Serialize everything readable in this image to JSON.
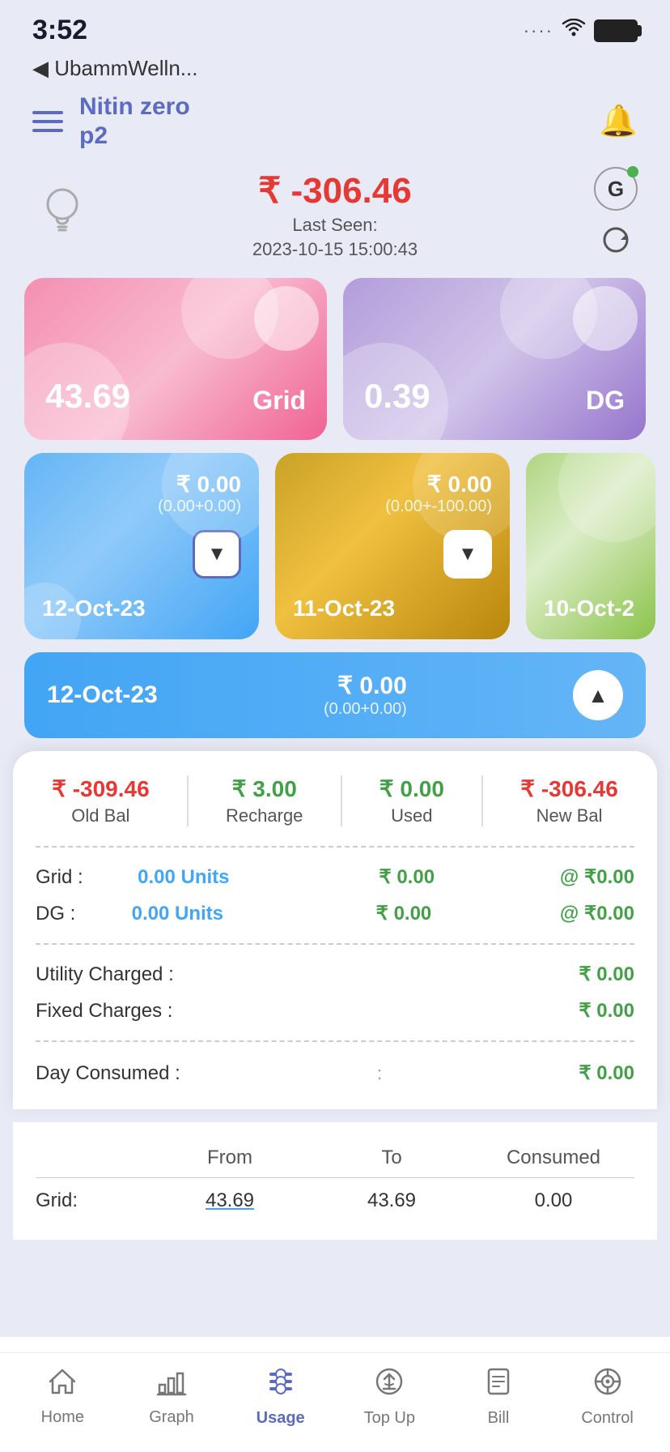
{
  "statusBar": {
    "time": "3:52",
    "backLabel": "◀ UbammWelln..."
  },
  "header": {
    "title": "Nitin zero\np2",
    "menuIcon": "☰",
    "bellIcon": "🔔"
  },
  "balance": {
    "amount": "₹ -306.46",
    "lastSeen": "Last Seen:",
    "lastSeenDate": "2023-10-15 15:00:43",
    "gLabel": "G"
  },
  "gridCard": {
    "value": "43.69",
    "label": "Grid"
  },
  "dgCard": {
    "value": "0.39",
    "label": "DG"
  },
  "dateCards": [
    {
      "amount": "₹ 0.00",
      "sub": "(0.00+0.00)",
      "date": "12-Oct-23",
      "type": "blue"
    },
    {
      "amount": "₹ 0.00",
      "sub": "(0.00+-100.00)",
      "date": "11-Oct-23",
      "type": "gold"
    },
    {
      "amount": "",
      "sub": "",
      "date": "10-Oct-2",
      "type": "green"
    }
  ],
  "expandedCard": {
    "date": "12-Oct-23",
    "amount": "₹ 0.00",
    "sub": "(0.00+0.00)"
  },
  "balanceDetail": {
    "oldBal": {
      "amount": "₹ -309.46",
      "label": "Old Bal"
    },
    "recharge": {
      "amount": "₹ 3.00",
      "label": "Recharge"
    },
    "used": {
      "amount": "₹ 0.00",
      "label": "Used"
    },
    "newBal": {
      "amount": "₹ -306.46",
      "label": "New Bal"
    }
  },
  "unitRows": [
    {
      "label": "Grid :",
      "units": "0.00 Units",
      "price": "₹ 0.00",
      "rate": "@ ₹0.00"
    },
    {
      "label": "DG :",
      "units": "0.00 Units",
      "price": "₹ 0.00",
      "rate": "@ ₹0.00"
    }
  ],
  "charges": [
    {
      "label": "Utility Charged :",
      "value": "₹ 0.00"
    },
    {
      "label": "Fixed Charges :",
      "value": "₹ 0.00"
    }
  ],
  "dayConsumed": {
    "label": "Day Consumed :",
    "value": "₹ 0.00"
  },
  "consumptionTable": {
    "headers": [
      "",
      "From",
      "To",
      "Consumed"
    ],
    "rows": [
      {
        "label": "Grid:",
        "from": "43.69",
        "to": "43.69",
        "consumed": "0.00"
      }
    ]
  },
  "bottomNav": [
    {
      "id": "home",
      "icon": "🏠",
      "label": "Home",
      "active": false
    },
    {
      "id": "graph",
      "icon": "📊",
      "label": "Graph",
      "active": false
    },
    {
      "id": "usage",
      "icon": "📋",
      "label": "Usage",
      "active": true
    },
    {
      "id": "topup",
      "icon": "⚡",
      "label": "Top Up",
      "active": false
    },
    {
      "id": "bill",
      "icon": "🧾",
      "label": "Bill",
      "active": false
    },
    {
      "id": "control",
      "icon": "⚙️",
      "label": "Control",
      "active": false
    }
  ]
}
